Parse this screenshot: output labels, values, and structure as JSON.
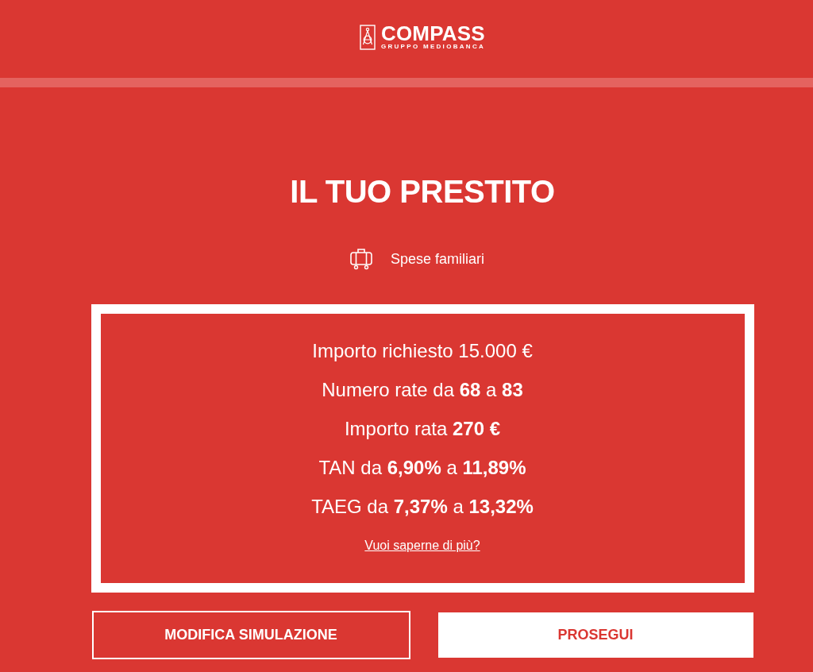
{
  "header": {
    "logo": {
      "name": "COMPASS",
      "tagline": "GRUPPO MEDIOBANCA"
    }
  },
  "title": "IL TUO PRESTITO",
  "category": {
    "label": "Spese familiari"
  },
  "summary": {
    "lines": [
      "Importo richiesto 15.000 €",
      "Numero rate da **68** a **83**",
      "Importo rata **270 €**",
      "TAN da **6,90%** a **11,89%**",
      "TAEG da **7,37%** a **13,32%**"
    ],
    "link": "Vuoi saperne di più?"
  },
  "buttons": [
    {
      "label": "MODIFICA SIMULAZIONE",
      "kind": "outline"
    },
    {
      "label": "PROSEGUI",
      "kind": "filled"
    }
  ]
}
